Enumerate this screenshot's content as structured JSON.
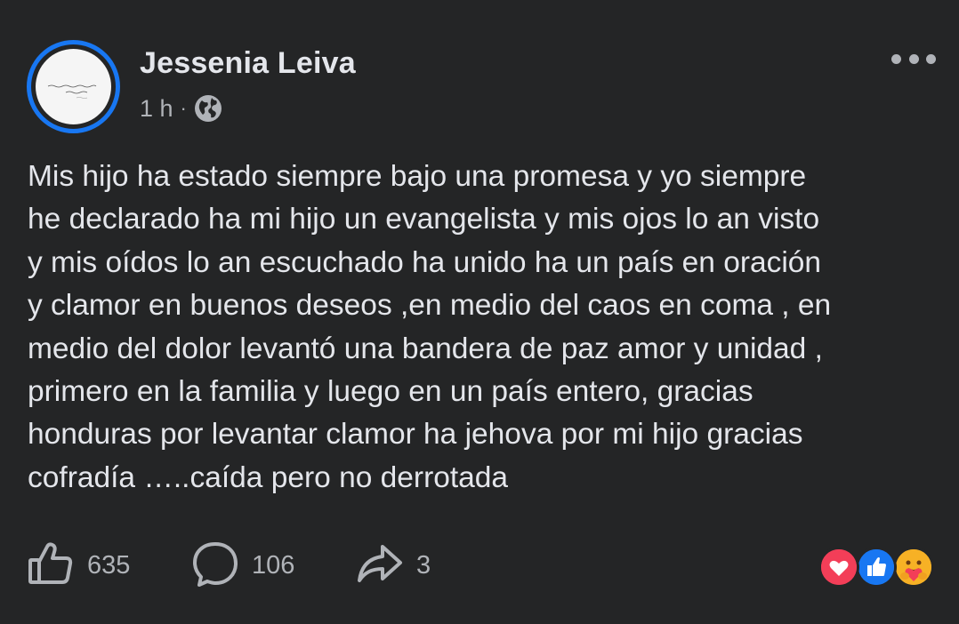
{
  "post": {
    "author": "Jessenia Leiva",
    "timestamp": "1 h",
    "separator": "·",
    "privacy_icon": "globe-icon",
    "text": "Mis hijo ha estado siempre  bajo una promesa y yo siempre\nhe declarado ha mi hijo un evangelista y mis ojos lo an visto\ny mis oídos lo an escuchado ha unido ha un país en oración\ny clamor en buenos deseos ,en medio del caos en coma , en\nmedio del dolor levantó una bandera de paz amor y unidad ,\nprimero en la familia y luego en un país entero, gracias\nhonduras por levantar clamor ha jehova por mi hijo gracias\ncofradía …..caída pero no derrotada"
  },
  "actions": {
    "like_count": "635",
    "comment_count": "106",
    "share_count": "3"
  },
  "reactions": [
    "love-reaction-icon",
    "like-reaction-icon",
    "care-reaction-icon"
  ],
  "colors": {
    "background": "#242526",
    "text": "#e4e6eb",
    "secondary_text": "#b0b3b8",
    "avatar_ring": "#1877f2",
    "love": "#f33e58",
    "like": "#1877f2",
    "care": "#f7b125"
  }
}
